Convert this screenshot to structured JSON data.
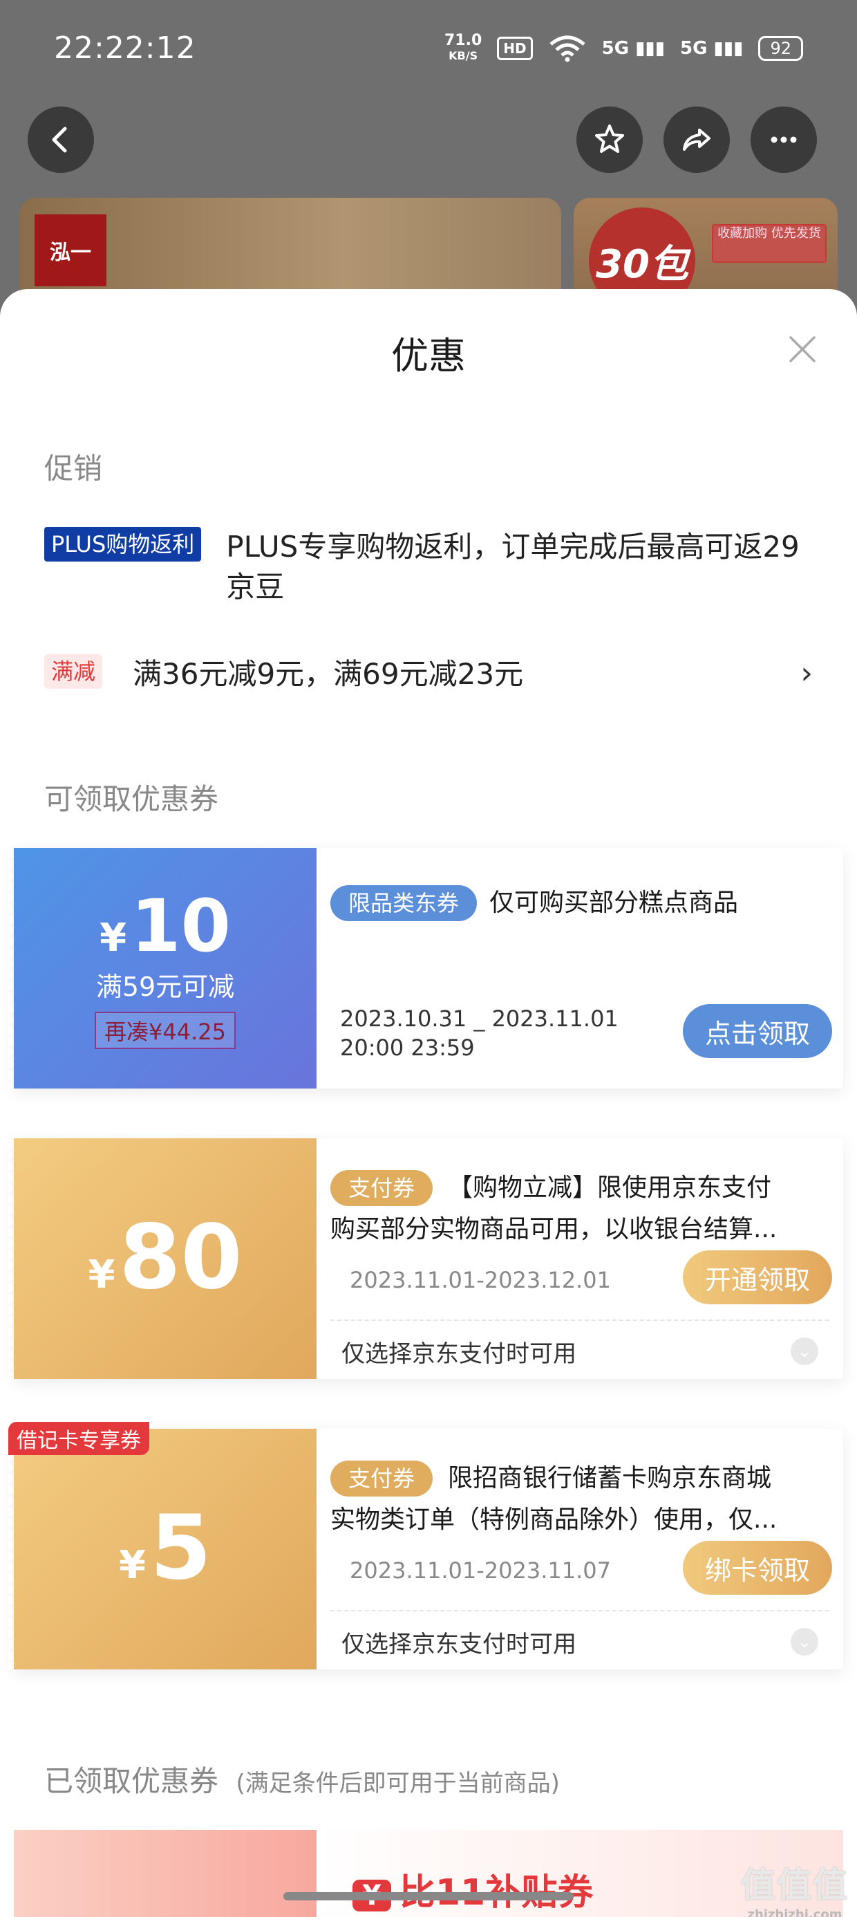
{
  "status_bar": {
    "time": "22:22:12",
    "speed_value": "71.0",
    "speed_unit": "KB/S",
    "hd": "HD",
    "signal1": "5G",
    "signal2": "5G",
    "battery": "92"
  },
  "background_product": {
    "brand_logo_text": "泓一",
    "badge_text": "30包",
    "tag_text": "收藏加购 优先发货"
  },
  "sheet": {
    "title": "优惠"
  },
  "promotion": {
    "section_label": "促销",
    "plus_tag": "PLUS购物返利",
    "plus_text": "PLUS专享购物返利，订单完成后最高可返29京豆",
    "man_tag": "满减",
    "man_text": "满36元减9元，满69元减23元"
  },
  "available_coupons": {
    "section_label": "可领取优惠券",
    "coupons": [
      {
        "currency": "¥",
        "amount": "10",
        "condition": "满59元可减",
        "gap": "再凑¥44.25",
        "tag": "限品类东券",
        "desc": "仅可购买部分糕点商品",
        "date_line1": "2023.10.31 _ 2023.11.01",
        "date_line2": "20:00 23:59",
        "action": "点击领取"
      },
      {
        "currency": "¥",
        "amount": "80",
        "tag": "支付券",
        "desc_line1": "【购物立减】限使用京东支付",
        "desc_line2": "购买部分实物商品可用，以收银台结算...",
        "dates": "2023.11.01-2023.12.01",
        "action": "开通领取",
        "footer": "仅选择京东支付时可用"
      },
      {
        "corner_tag": "借记卡专享券",
        "currency": "¥",
        "amount": "5",
        "tag": "支付券",
        "desc_line1": "限招商银行储蓄卡购京东商城",
        "desc_line2": "实物类订单（特例商品除外）使用，仅...",
        "dates": "2023.11.01-2023.11.07",
        "action": "绑卡领取",
        "footer": "仅选择京东支付时可用"
      }
    ]
  },
  "claimed_coupons": {
    "section_label": "已领取优惠券",
    "note": "(满足条件后即可用于当前商品)",
    "partial_title": "比11补贴券",
    "partial_badge": "¥"
  },
  "watermark": {
    "big": "值值值",
    "small": "zhizhizhi.com"
  }
}
